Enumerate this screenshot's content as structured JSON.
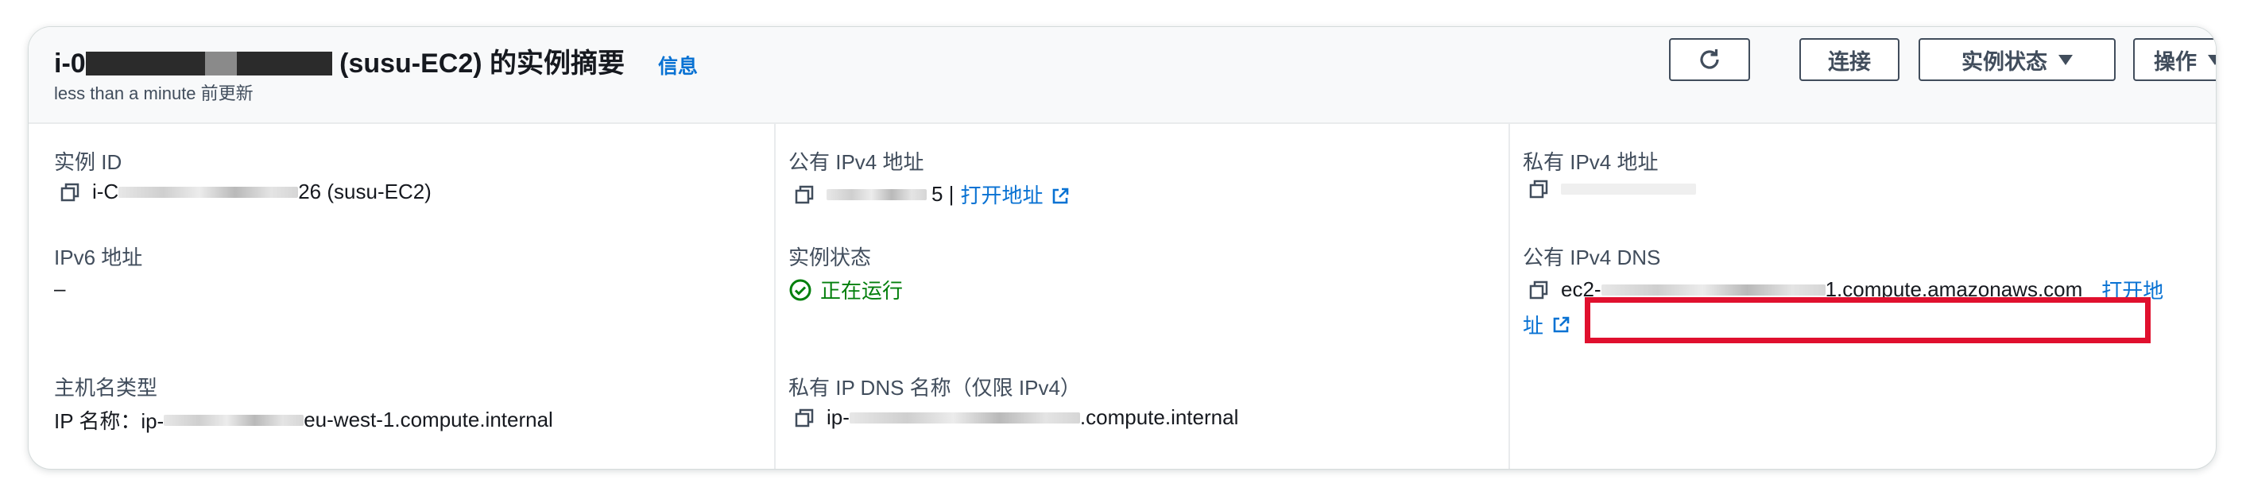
{
  "header": {
    "title_prefix": "i-0",
    "title_suffix": " (susu-EC2) 的实例摘要",
    "info_link": "信息",
    "subtitle": "less than a minute 前更新",
    "buttons": {
      "refresh_icon": "refresh-icon",
      "connect": "连接",
      "instance_state": "实例状态",
      "actions": "操作"
    }
  },
  "col1": {
    "instance_id_label": "实例 ID",
    "instance_id_prefix": "i-C",
    "instance_id_suffix": "26 (susu-EC2)",
    "ipv6_label": "IPv6 地址",
    "ipv6_value": "–",
    "hostname_type_label": "主机名类型",
    "hostname_prefix": "IP 名称：ip-",
    "hostname_suffix": "eu-west-1.compute.internal"
  },
  "col2": {
    "public_ipv4_label": "公有 IPv4 地址",
    "public_ipv4_suffix": "5 |",
    "open_address": "打开地址",
    "instance_state_label": "实例状态",
    "instance_state_value": "正在运行",
    "private_dns_label": "私有 IP DNS 名称（仅限 IPv4）",
    "private_dns_prefix": "ip-",
    "private_dns_suffix": ".compute.internal"
  },
  "col3": {
    "private_ipv4_label": "私有 IPv4 地址",
    "public_dns_label": "公有 IPv4 DNS",
    "public_dns_prefix": "ec2-",
    "public_dns_suffix": "1.compute.amazonaws.com",
    "open_address_line1": "打开地",
    "open_address_line2": "址"
  },
  "colors": {
    "link": "#0972d3",
    "running": "#037f0c",
    "highlight": "#e0102e"
  }
}
